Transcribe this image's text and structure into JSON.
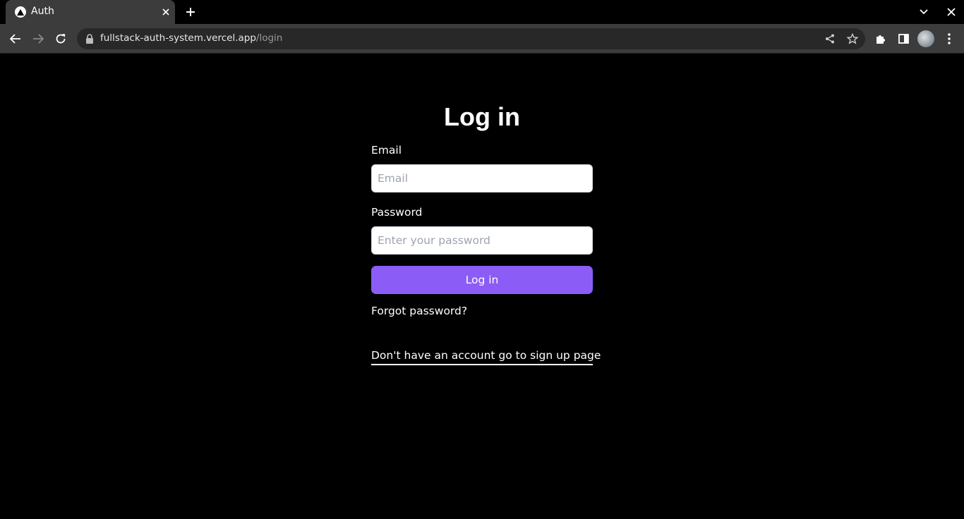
{
  "browser": {
    "tab": {
      "title": "Auth"
    },
    "url": {
      "host": "fullstack-auth-system.vercel.app",
      "path": "/login"
    }
  },
  "login": {
    "title": "Log in",
    "email_label": "Email",
    "email_placeholder": "Email",
    "email_value": "",
    "password_label": "Password",
    "password_placeholder": "Enter your password",
    "password_value": "",
    "submit_label": "Log in",
    "forgot_link": "Forgot password?",
    "signup_link": "Don't have an account go to sign up page"
  },
  "colors": {
    "background": "#000000",
    "button": "#8b5cf6",
    "input_background": "#ffffff",
    "chrome": "#3c3c3c"
  },
  "icons": [
    "vercel-triangle-icon",
    "close-icon",
    "plus-icon",
    "chevron-down-icon",
    "back-arrow-icon",
    "forward-arrow-icon",
    "reload-icon",
    "lock-icon",
    "share-icon",
    "star-icon",
    "puzzle-icon",
    "side-panel-icon",
    "more-vert-icon"
  ]
}
